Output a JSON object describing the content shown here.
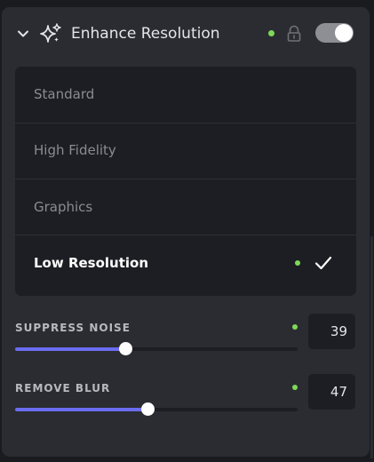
{
  "header": {
    "title": "Enhance Resolution",
    "status_color": "#7ed957",
    "toggle_on": true,
    "icons": [
      "chevron-down-icon",
      "sparkles-icon",
      "lock-icon"
    ]
  },
  "options": [
    {
      "label": "Standard",
      "selected": false
    },
    {
      "label": "High Fidelity",
      "selected": false
    },
    {
      "label": "Graphics",
      "selected": false
    },
    {
      "label": "Low Resolution",
      "selected": true
    }
  ],
  "sliders": [
    {
      "label": "SUPPRESS NOISE",
      "value": "39",
      "fraction": 0.39
    },
    {
      "label": "REMOVE BLUR",
      "value": "47",
      "fraction": 0.47
    }
  ],
  "colors": {
    "panel": "#2b2c31",
    "accent": "#6b6cf0",
    "active_dot": "#7ed957"
  }
}
